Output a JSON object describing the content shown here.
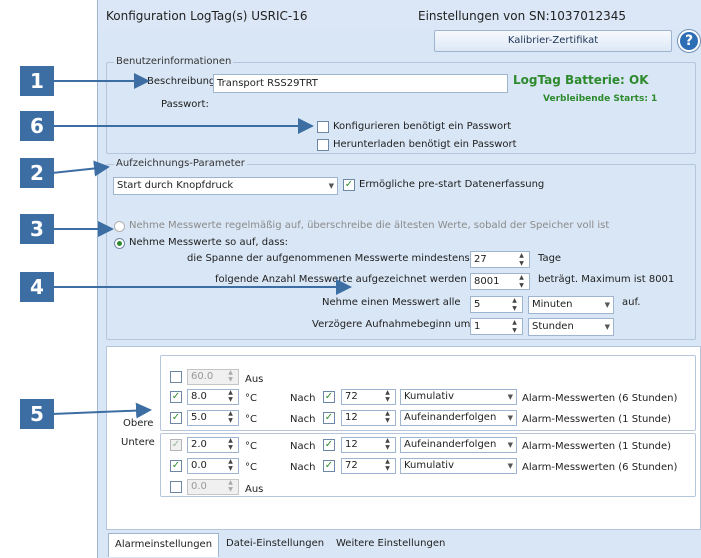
{
  "header": {
    "title": "Konfiguration LogTag(s) USRIC-16",
    "settings_from": "Einstellungen von SN:1037012345",
    "calibration_button": "Kalibrier-Zertifikat",
    "help": "?"
  },
  "callouts": [
    "1",
    "6",
    "2",
    "3",
    "4",
    "5"
  ],
  "user_info": {
    "group_label": "Benutzerinformationen",
    "description_label": "Beschreibung:",
    "description_value": "Transport RSS29TRT",
    "password_label": "Passwort:",
    "battery": "LogTag Batterie: OK",
    "starts_left": "Verbleibende Starts: 1",
    "config_pw": "Konfigurieren benötigt ein Passwort",
    "download_pw": "Herunterladen benötigt ein Passwort"
  },
  "recording": {
    "group_label": "Aufzeichnungs-Parameter",
    "start_mode": "Start durch Knopfdruck",
    "prestart": "Ermögliche pre-start Datenerfassung",
    "overwrite_option": "Nehme Messwerte regelmäßig auf, überschreibe die ältesten Werte, sobald der Speicher voll ist",
    "stop_option": "Nehme Messwerte so auf, dass:",
    "span_label": "die Spanne der aufgenommenen Messwerte mindestens",
    "span_value": "27",
    "span_unit": "Tage",
    "count_label": "folgende Anzahl Messwerte aufgezeichnet werden",
    "count_value": "8001",
    "count_note": "beträgt. Maximum ist 8001",
    "interval_label": "Nehme einen Messwert alle",
    "interval_value": "5",
    "interval_unit": "Minuten",
    "interval_suffix": "auf.",
    "delay_label": "Verzögere Aufnahmebeginn um",
    "delay_value": "1",
    "delay_unit": "Stunden"
  },
  "alarms": {
    "upper_label": "Obere",
    "lower_label": "Untere",
    "off_label": "Aus",
    "unit": "°C",
    "after_label": "Nach",
    "rows": [
      {
        "value": "60.0",
        "kind": "off"
      },
      {
        "value": "8.0",
        "count": "72",
        "mode": "Kumulativ",
        "desc": "Alarm-Messwerten (6 Stunden)"
      },
      {
        "value": "5.0",
        "count": "12",
        "mode": "Aufeinanderfolgen",
        "desc": "Alarm-Messwerten (1 Stunde)"
      },
      {
        "value": "2.0",
        "count": "12",
        "mode": "Aufeinanderfolgen",
        "desc": "Alarm-Messwerten (1 Stunde)"
      },
      {
        "value": "0.0",
        "count": "72",
        "mode": "Kumulativ",
        "desc": "Alarm-Messwerten (6 Stunden)"
      },
      {
        "value": "0.0",
        "kind": "off"
      }
    ]
  },
  "tabs": [
    "Alarmeinstellungen",
    "Datei-Einstellungen",
    "Weitere Einstellungen"
  ],
  "colors": {
    "accent": "#3d6ea3",
    "ok_green": "#2d8a2d",
    "window_bg": "#d9e6f5"
  }
}
